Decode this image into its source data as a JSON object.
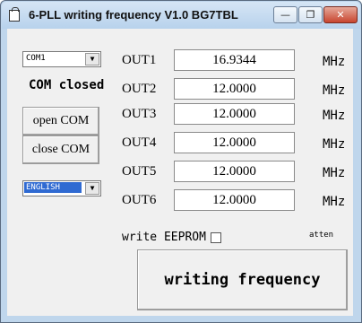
{
  "window": {
    "title": "6-PLL writing frequency V1.0 BG7TBL"
  },
  "caption_buttons": {
    "minimize": "—",
    "maximize": "❐",
    "close": "✕"
  },
  "left_panel": {
    "com_port": "COM1",
    "status": "COM closed",
    "open_button": "open COM",
    "close_button": "close COM",
    "language": "ENGLISH"
  },
  "outputs": [
    {
      "label": "OUT1",
      "value": "16.9344",
      "unit": "MHz"
    },
    {
      "label": "OUT2",
      "value": "12.0000",
      "unit": "MHz"
    },
    {
      "label": "OUT3",
      "value": "12.0000",
      "unit": "MHz"
    },
    {
      "label": "OUT4",
      "value": "12.0000",
      "unit": "MHz"
    },
    {
      "label": "OUT5",
      "value": "12.0000",
      "unit": "MHz"
    },
    {
      "label": "OUT6",
      "value": "12.0000",
      "unit": "MHz"
    }
  ],
  "eeprom": {
    "label": "write EEPROM",
    "checked": false
  },
  "atten_label": "atten",
  "write_button": "writing frequency"
}
